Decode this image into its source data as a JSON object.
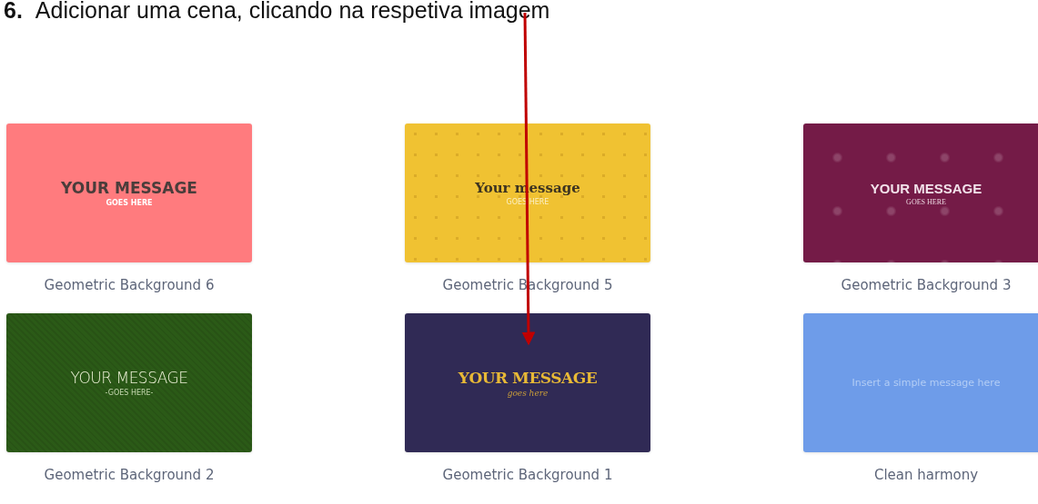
{
  "instruction": {
    "number": "6.",
    "text": "Adicionar uma cena, clicando na respetiva imagem"
  },
  "templates": [
    {
      "name": "Geometric Background 6",
      "kind": "bold",
      "color": "#ff7b7e",
      "message": "YOUR MESSAGE",
      "sub": "GOES HERE"
    },
    {
      "name": "Geometric Background 5",
      "kind": "serif",
      "color": "#f0c232",
      "message": "Your message",
      "sub": "GOES HERE"
    },
    {
      "name": "Geometric Background 3",
      "kind": "condensed",
      "color": "#741b47",
      "message": "YOUR MESSAGE",
      "sub": "GOES HERE"
    },
    {
      "name": "Geometric Background 2",
      "kind": "thin",
      "color": "#2b5a17",
      "message": "YOUR MESSAGE",
      "sub": "-GOES HERE-"
    },
    {
      "name": "Geometric Background 1",
      "kind": "varsity",
      "color": "#302a55",
      "message": "YOUR MESSAGE",
      "sub": "goes here"
    },
    {
      "name": "Clean harmony",
      "kind": "simple",
      "color": "#6e9ce9",
      "message": "Insert a simple message here"
    }
  ]
}
